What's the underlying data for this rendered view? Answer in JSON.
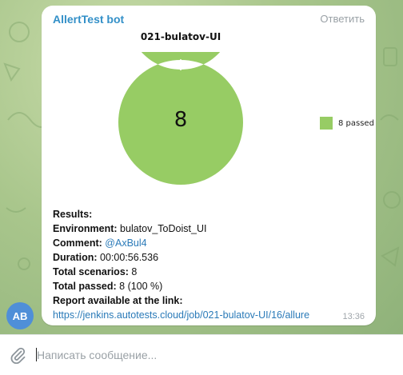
{
  "message": {
    "sender": "AllertTest bot",
    "reply_label": "Ответить",
    "time": "13:36",
    "avatar_initials": "AB"
  },
  "chart_data": {
    "type": "pie",
    "title": "021-bulatov-UI",
    "center_value": "8",
    "categories": [
      "8 passed"
    ],
    "values": [
      8
    ],
    "colors": [
      "#97cc64"
    ],
    "legend_position": "right"
  },
  "report": {
    "results_label": "Results:",
    "environment_label": "Environment:",
    "environment_value": "bulatov_ToDoist_UI",
    "comment_label": "Comment:",
    "comment_value": "@AxBul4",
    "duration_label": "Duration:",
    "duration_value": "00:00:56.536",
    "scenarios_label": "Total scenarios:",
    "scenarios_value": "8",
    "passed_label": "Total passed:",
    "passed_value": "8 (100 %)",
    "link_label": "Report available at the link:",
    "link_url": "https://jenkins.autotests.cloud/job/021-bulatov-UI/16/allure"
  },
  "composer": {
    "placeholder": "Написать сообщение..."
  },
  "icons": {
    "attach": "paperclip-icon"
  }
}
